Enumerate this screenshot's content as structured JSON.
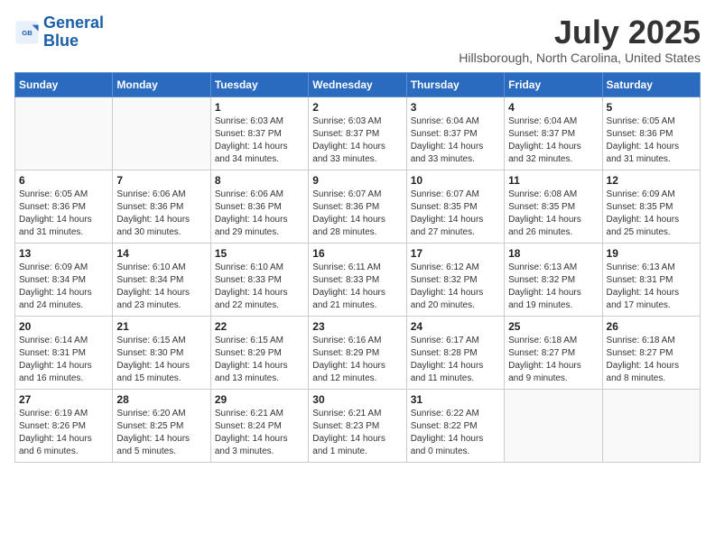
{
  "header": {
    "logo_general": "General",
    "logo_blue": "Blue",
    "month_year": "July 2025",
    "location": "Hillsborough, North Carolina, United States"
  },
  "weekdays": [
    "Sunday",
    "Monday",
    "Tuesday",
    "Wednesday",
    "Thursday",
    "Friday",
    "Saturday"
  ],
  "weeks": [
    [
      {
        "day": "",
        "info": ""
      },
      {
        "day": "",
        "info": ""
      },
      {
        "day": "1",
        "info": "Sunrise: 6:03 AM\nSunset: 8:37 PM\nDaylight: 14 hours\nand 34 minutes."
      },
      {
        "day": "2",
        "info": "Sunrise: 6:03 AM\nSunset: 8:37 PM\nDaylight: 14 hours\nand 33 minutes."
      },
      {
        "day": "3",
        "info": "Sunrise: 6:04 AM\nSunset: 8:37 PM\nDaylight: 14 hours\nand 33 minutes."
      },
      {
        "day": "4",
        "info": "Sunrise: 6:04 AM\nSunset: 8:37 PM\nDaylight: 14 hours\nand 32 minutes."
      },
      {
        "day": "5",
        "info": "Sunrise: 6:05 AM\nSunset: 8:36 PM\nDaylight: 14 hours\nand 31 minutes."
      }
    ],
    [
      {
        "day": "6",
        "info": "Sunrise: 6:05 AM\nSunset: 8:36 PM\nDaylight: 14 hours\nand 31 minutes."
      },
      {
        "day": "7",
        "info": "Sunrise: 6:06 AM\nSunset: 8:36 PM\nDaylight: 14 hours\nand 30 minutes."
      },
      {
        "day": "8",
        "info": "Sunrise: 6:06 AM\nSunset: 8:36 PM\nDaylight: 14 hours\nand 29 minutes."
      },
      {
        "day": "9",
        "info": "Sunrise: 6:07 AM\nSunset: 8:36 PM\nDaylight: 14 hours\nand 28 minutes."
      },
      {
        "day": "10",
        "info": "Sunrise: 6:07 AM\nSunset: 8:35 PM\nDaylight: 14 hours\nand 27 minutes."
      },
      {
        "day": "11",
        "info": "Sunrise: 6:08 AM\nSunset: 8:35 PM\nDaylight: 14 hours\nand 26 minutes."
      },
      {
        "day": "12",
        "info": "Sunrise: 6:09 AM\nSunset: 8:35 PM\nDaylight: 14 hours\nand 25 minutes."
      }
    ],
    [
      {
        "day": "13",
        "info": "Sunrise: 6:09 AM\nSunset: 8:34 PM\nDaylight: 14 hours\nand 24 minutes."
      },
      {
        "day": "14",
        "info": "Sunrise: 6:10 AM\nSunset: 8:34 PM\nDaylight: 14 hours\nand 23 minutes."
      },
      {
        "day": "15",
        "info": "Sunrise: 6:10 AM\nSunset: 8:33 PM\nDaylight: 14 hours\nand 22 minutes."
      },
      {
        "day": "16",
        "info": "Sunrise: 6:11 AM\nSunset: 8:33 PM\nDaylight: 14 hours\nand 21 minutes."
      },
      {
        "day": "17",
        "info": "Sunrise: 6:12 AM\nSunset: 8:32 PM\nDaylight: 14 hours\nand 20 minutes."
      },
      {
        "day": "18",
        "info": "Sunrise: 6:13 AM\nSunset: 8:32 PM\nDaylight: 14 hours\nand 19 minutes."
      },
      {
        "day": "19",
        "info": "Sunrise: 6:13 AM\nSunset: 8:31 PM\nDaylight: 14 hours\nand 17 minutes."
      }
    ],
    [
      {
        "day": "20",
        "info": "Sunrise: 6:14 AM\nSunset: 8:31 PM\nDaylight: 14 hours\nand 16 minutes."
      },
      {
        "day": "21",
        "info": "Sunrise: 6:15 AM\nSunset: 8:30 PM\nDaylight: 14 hours\nand 15 minutes."
      },
      {
        "day": "22",
        "info": "Sunrise: 6:15 AM\nSunset: 8:29 PM\nDaylight: 14 hours\nand 13 minutes."
      },
      {
        "day": "23",
        "info": "Sunrise: 6:16 AM\nSunset: 8:29 PM\nDaylight: 14 hours\nand 12 minutes."
      },
      {
        "day": "24",
        "info": "Sunrise: 6:17 AM\nSunset: 8:28 PM\nDaylight: 14 hours\nand 11 minutes."
      },
      {
        "day": "25",
        "info": "Sunrise: 6:18 AM\nSunset: 8:27 PM\nDaylight: 14 hours\nand 9 minutes."
      },
      {
        "day": "26",
        "info": "Sunrise: 6:18 AM\nSunset: 8:27 PM\nDaylight: 14 hours\nand 8 minutes."
      }
    ],
    [
      {
        "day": "27",
        "info": "Sunrise: 6:19 AM\nSunset: 8:26 PM\nDaylight: 14 hours\nand 6 minutes."
      },
      {
        "day": "28",
        "info": "Sunrise: 6:20 AM\nSunset: 8:25 PM\nDaylight: 14 hours\nand 5 minutes."
      },
      {
        "day": "29",
        "info": "Sunrise: 6:21 AM\nSunset: 8:24 PM\nDaylight: 14 hours\nand 3 minutes."
      },
      {
        "day": "30",
        "info": "Sunrise: 6:21 AM\nSunset: 8:23 PM\nDaylight: 14 hours\nand 1 minute."
      },
      {
        "day": "31",
        "info": "Sunrise: 6:22 AM\nSunset: 8:22 PM\nDaylight: 14 hours\nand 0 minutes."
      },
      {
        "day": "",
        "info": ""
      },
      {
        "day": "",
        "info": ""
      }
    ]
  ]
}
